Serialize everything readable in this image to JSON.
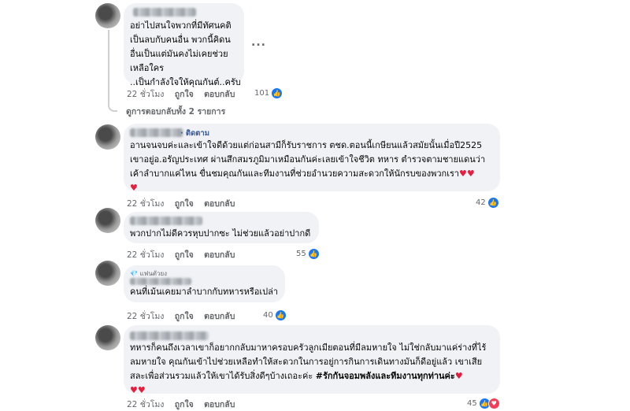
{
  "comments": [
    {
      "lines": [
        "อย่าไปสนใจพวกที่มีทัศนคติ",
        "เป็นลบกับคนอื่น พวกนี้คิดน",
        "อื่นเป็นแต่มันคงไม่เคยช่วย",
        "เหลือใคร",
        "..เป็นกำลังใจให้คุณกันต์..ครับ"
      ],
      "time": "22 ชั่วโมง",
      "like": "ถูกใจ",
      "reply": "ตอบกลับ",
      "reactions": "101"
    },
    {
      "follow": "· ติดตาม",
      "lines": [
        "อานจนจบค่ะและเข้าใจดีด้วยแต่ก่อนสามีก็รับราชการ ตชด.ตอนนี้เกษียนแล้วสมัยนั้นเมื่อปี2525",
        "เขาอยู่อ.อรัญประเทศ ผ่านสึกสมรภูมิมาเหมือนกันค่ะเลยเข้าใจชีวิต ทหาร ตำรวจตามชายแดนว่า",
        "เค้าลำบากแค่ไหน ขื่นชมคุณกันและทีมงานที่ช่วยอำนวยความสะดวกให้นักรบของพวกเรา"
      ],
      "time": "22 ชั่วโมง",
      "like": "ถูกใจ",
      "reply": "ตอบกลับ",
      "reactions": "42"
    },
    {
      "lines": [
        "พวกปากไม่ดีควรหุบปากซะ ไม่ช่วยแล้วอย่าปากดี"
      ],
      "time": "22 ชั่วโมง",
      "like": "ถูกใจ",
      "reply": "ตอบกลับ",
      "reactions": "55"
    },
    {
      "badge": "💎 แฟนตัวยง",
      "lines": [
        "คนที่เม้นเคยมาลำบากกับทหารหรือเปล่า"
      ],
      "time": "22 ชั่วโมง",
      "like": "ถูกใจ",
      "reply": "ตอบกลับ",
      "reactions": "40"
    },
    {
      "lines": [
        "ทหารก็คนถึงเวลาเขาก็อยากกลับมาหาครอบครัวลูกเมียตอนที่มีลมหายใจ ไม่ใช่กลับมาแค่ร่างที่ไร้",
        "ลมหายใจ คุณกันเข้าไปช่วยเหลือทำให้สะดวกในการอยู่การกินการเดินทางมันก็ดีอยู่แล้ว เขาเสีย",
        "สละเพื่อส่วนรวมแล้วให้เขาได้รับสิ่งดีๆบ้างเถอะค่ะ "
      ],
      "hashtag": "#รักกันจอมพลังและทีมงานทุกท่านค่ะ",
      "time": "22 ชั่วโมง",
      "like": "ถูกใจ",
      "reply": "ตอบกลับ",
      "reactions": "45"
    }
  ],
  "view_replies": "ดูการตอบกลับทั้ง 2 รายการ",
  "more_label": "...",
  "hearts": "♥",
  "like_icon": "👍",
  "heart_icon": "♥"
}
